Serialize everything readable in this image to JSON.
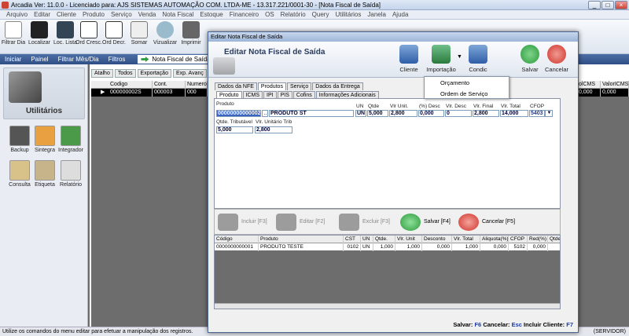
{
  "app": {
    "title": "Arcadia Ver: 11.0.0 - Licenciado para: AJS SISTEMAS AUTOMAÇÃO COM. LTDA-ME - 13.317.221/0001-30 - [Nota Fiscal de Saída]",
    "min": "_",
    "max": "□",
    "close": "×"
  },
  "menu": [
    "Arquivo",
    "Editar",
    "Cliente",
    "Produto",
    "Serviço",
    "Venda",
    "Nota Fiscal",
    "Estoque",
    "Financeiro",
    "OS",
    "Relatório",
    "Query",
    "Utilitários",
    "Janela",
    "Ajuda"
  ],
  "toolbar": [
    {
      "label": "Filtrar Dia",
      "icon": "calendar-icon"
    },
    {
      "label": "Localizar",
      "icon": "binoculars-icon"
    },
    {
      "label": "Loc. Lista",
      "icon": "list-search-icon"
    },
    {
      "label": "Ord Cresc.",
      "icon": "sort-asc-icon"
    },
    {
      "label": "Ord Decr.",
      "icon": "sort-desc-icon"
    },
    {
      "label": "Somar",
      "icon": "sum-icon"
    },
    {
      "label": "Vizualizar",
      "icon": "preview-icon"
    },
    {
      "label": "Imprimir",
      "icon": "printer-icon"
    }
  ],
  "nav": {
    "iniciar": "Iniciar",
    "painel": "Painel",
    "filtrar": "Filtrar Mês/Dia",
    "filtros": "Filtros",
    "active": "Nota Fiscal de Saída"
  },
  "left": {
    "title": "Utilitários",
    "buttons": [
      {
        "label": "Backup",
        "icon": "backup-icon"
      },
      {
        "label": "Sintegra",
        "icon": "sintegra-icon"
      },
      {
        "label": "Integrador",
        "icon": "integrator-icon"
      },
      {
        "label": "Consulta",
        "icon": "query-icon"
      },
      {
        "label": "Etiqueta",
        "icon": "label-icon"
      },
      {
        "label": "Relatório",
        "icon": "report-icon"
      }
    ]
  },
  "bg": {
    "tabs": [
      "Atalho",
      "Todos",
      "Exportação",
      "Exp. Avanç"
    ],
    "headers": [
      "Codigo",
      "Cont. Interno",
      "Numero"
    ],
    "row": [
      "000000002S",
      "000003",
      "000"
    ],
    "right_headers": [
      "olCMS",
      "ValorICMS"
    ],
    "right_row": [
      "0,000",
      "0,000"
    ]
  },
  "dialog": {
    "title": "Editar Nota Fiscal de Saída",
    "header_title": "Editar Nota Fiscal de Saída",
    "buttons": {
      "cliente": "Cliente",
      "importacao": "Importação",
      "condic": "Condic",
      "salvar": "Salvar",
      "cancelar": "Cancelar"
    },
    "dropdown": [
      "Orçamento",
      "Ordem de Serviço"
    ],
    "tabs_main": [
      "Dados da NFE",
      "Produtos",
      "Serviço",
      "Dados da Entrega"
    ],
    "tabs_sub": [
      "Produto",
      "ICMS",
      "IPI",
      "PIS",
      "Cofins",
      "Informações Adicionais"
    ],
    "fields": {
      "produto_label": "Produto",
      "produto_code": "00000000000002",
      "produto_desc": "PRODUTO ST",
      "un_label": "UN",
      "un": "UN",
      "qtde_label": "Qtde",
      "qtde": "5,000",
      "vlrunit_label": "Vlr Unit.",
      "vlrunit": "2,800",
      "desc_label": "(%) Desc",
      "desc": "0,000",
      "vlrdesc_label": "Vlr. Desc",
      "vlrdesc": "0",
      "vlrfinal_label": "Vlr. Final",
      "vlrfinal": "2,800",
      "vlrtotal_label": "Vlr. Total",
      "vlrtotal": "14,000",
      "cfop_label": "CFOP",
      "cfop": "5403",
      "qtdetrib_label": "Qtde. Tributável",
      "qtdetrib": "5,000",
      "vlrunittrib_label": "Vlr. Unitário Trib",
      "vlrunittrib": "2,800"
    },
    "actions": {
      "incluir": "Incluir [F3]",
      "editar": "Editar [F2]",
      "excluir": "Excluir [F3]",
      "salvar": "Salvar [F4]",
      "cancelar": "Cancelar [F5]"
    },
    "grid_headers": [
      "Código",
      "Produto",
      "CST",
      "UN",
      "Qtde.",
      "Vlr. Unit",
      "Desconto",
      "Vlr. Total",
      "Aliquota(%)",
      "CFOP",
      "Red(%)",
      "Qtde"
    ],
    "grid_row": [
      "0000000000001",
      "PRODUTO TESTE",
      "0102",
      "UN",
      "1,000",
      "1,000",
      "0,000",
      "1,000",
      "0,000",
      "5102",
      "0,000",
      ""
    ],
    "status": {
      "salvar_label": "Salvar:",
      "salvar_key": "F6",
      "cancelar_label": "Cancelar:",
      "cancelar_key": "Esc",
      "incluir_label": "Incluir Cliente:",
      "incluir_key": "F7"
    }
  },
  "status": {
    "text": "Utilize os comandos do menu editar para efetuar a manipulação dos registros.",
    "right": "(SERVIDOR)"
  },
  "colors": {
    "accent": "#2f4f86",
    "selection": "#3a63c2",
    "ok": "#2b9a3c",
    "cancel": "#d0332a"
  }
}
